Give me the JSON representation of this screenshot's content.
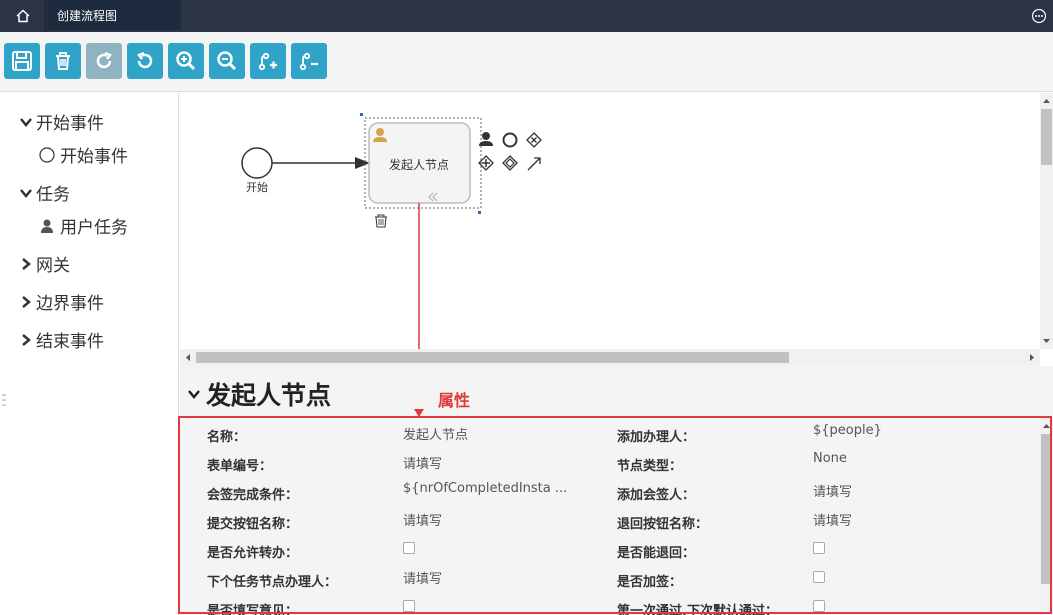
{
  "topbar": {
    "tab_title": "创建流程图"
  },
  "toolbar": {
    "buttons": [
      {
        "name": "save",
        "icon": "save-icon"
      },
      {
        "name": "delete",
        "icon": "trash-icon"
      },
      {
        "name": "redo",
        "icon": "redo-icon",
        "disabled": true
      },
      {
        "name": "undo",
        "icon": "undo-icon"
      },
      {
        "name": "zoom-in",
        "icon": "zoom-in-icon"
      },
      {
        "name": "zoom-out",
        "icon": "zoom-out-icon"
      },
      {
        "name": "add-branch",
        "icon": "branch-add-icon"
      },
      {
        "name": "remove-branch",
        "icon": "branch-remove-icon"
      }
    ],
    "accent_color": "#2fa4c8"
  },
  "palette": {
    "groups": [
      {
        "label": "开始事件",
        "expanded": true,
        "items": [
          {
            "label": "开始事件",
            "icon": "circle-icon"
          }
        ]
      },
      {
        "label": "任务",
        "expanded": true,
        "items": [
          {
            "label": "用户任务",
            "icon": "user-icon"
          }
        ]
      },
      {
        "label": "网关",
        "expanded": false,
        "items": []
      },
      {
        "label": "边界事件",
        "expanded": false,
        "items": []
      },
      {
        "label": "结束事件",
        "expanded": false,
        "items": []
      }
    ]
  },
  "canvas": {
    "start_event_label": "开始",
    "task_label": "发起人节点"
  },
  "properties": {
    "title": "发起人节点",
    "annotation": "属性",
    "rows": [
      {
        "left_label": "名称：",
        "left_value": "发起人节点",
        "right_label": "添加办理人：",
        "right_value": "${people}"
      },
      {
        "left_label": "表单编号：",
        "left_value": "请填写",
        "right_label": "节点类型：",
        "right_value": "None"
      },
      {
        "left_label": "会签完成条件：",
        "left_value": "${nrOfCompletedInsta ...",
        "right_label": "添加会签人：",
        "right_value": "请填写"
      },
      {
        "left_label": "提交按钮名称：",
        "left_value": "请填写",
        "right_label": "退回按钮名称：",
        "right_value": "请填写"
      },
      {
        "left_label": "是否允许转办：",
        "left_checkbox": true,
        "right_label": "是否能退回：",
        "right_checkbox": true
      },
      {
        "left_label": "下个任务节点办理人：",
        "left_value": "请填写",
        "right_label": "是否加签：",
        "right_checkbox": true
      },
      {
        "left_label": "是否填写意见：",
        "left_checkbox": true,
        "right_label": "第一次通过,下次默认通过：",
        "right_checkbox": true
      }
    ],
    "highlight_color": "#e03a3a"
  }
}
